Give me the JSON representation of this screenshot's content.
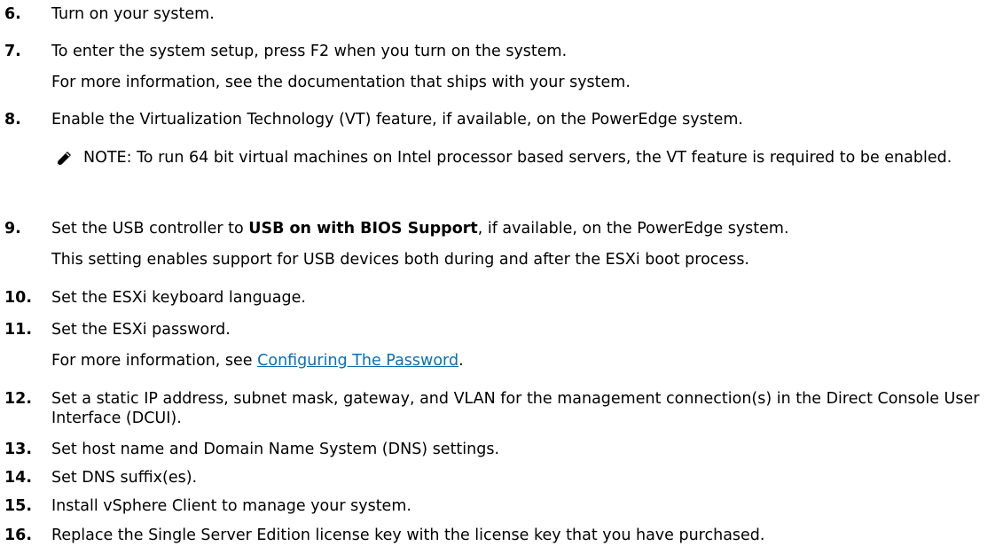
{
  "steps": [
    {
      "num": "6.",
      "text": "Turn on your system."
    },
    {
      "num": "7.",
      "text": "To enter the system setup, press F2 when you turn on the system.",
      "sub": "For more information, see the documentation that ships with your system."
    },
    {
      "num": "8.",
      "text": "Enable the Virtualization Technology (VT) feature, if available, on the PowerEdge system.",
      "note_label": "NOTE:",
      "note_text": " To run 64 bit virtual machines on Intel processor based servers, the VT feature is required to be enabled.",
      "note_icon": "pencil-note-icon"
    },
    {
      "num": "9.",
      "text_pre": "Set the USB controller to ",
      "text_bold": "USB on with BIOS Support",
      "text_post": ", if available, on the PowerEdge system.",
      "sub": "This setting enables support for USB devices both during and after the ESXi boot process."
    },
    {
      "num": "10.",
      "text": "Set the ESXi keyboard language."
    },
    {
      "num": "11.",
      "text": "Set the ESXi password.",
      "sub_pre": "For more information, see ",
      "sub_link": "Configuring The Password",
      "sub_post": "."
    },
    {
      "num": "12.",
      "text": "Set a static IP address, subnet mask, gateway, and VLAN for the management connection(s) in the Direct Console User Interface (DCUI)."
    },
    {
      "num": "13.",
      "text": "Set host name and Domain Name System (DNS) settings."
    },
    {
      "num": "14.",
      "text": "Set DNS suffix(es)."
    },
    {
      "num": "15.",
      "text": "Install vSphere Client to manage your system."
    },
    {
      "num": "16.",
      "text": "Replace the Single Server Edition license key with the license key that you have purchased."
    }
  ],
  "colors": {
    "link": "#0b6fb4",
    "text": "#000000"
  }
}
